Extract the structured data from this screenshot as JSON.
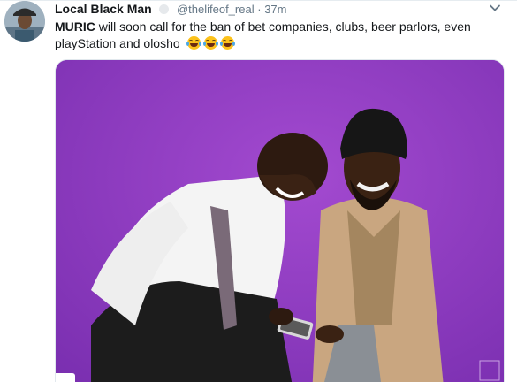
{
  "tweet": {
    "author_name": "Local Black Man",
    "handle": "@thelifeof_real",
    "separator": "·",
    "time": "37m",
    "text_bold": "MURIC",
    "text_rest": " will soon call for the ban of bet companies, clubs, beer parlors, even playStation and olosho",
    "emojis": [
      "face-with-tears-of-joy",
      "face-with-tears-of-joy",
      "face-with-tears-of-joy"
    ]
  },
  "icons": {
    "avatar": "user-avatar",
    "caret": "chevron-down-icon",
    "verified": "verified-badge-icon"
  },
  "media": {
    "description_icon": "photo",
    "corner_badge": "\""
  },
  "colors": {
    "name": "#14171a",
    "muted": "#657786",
    "photo_background": "#8a3bbf"
  }
}
